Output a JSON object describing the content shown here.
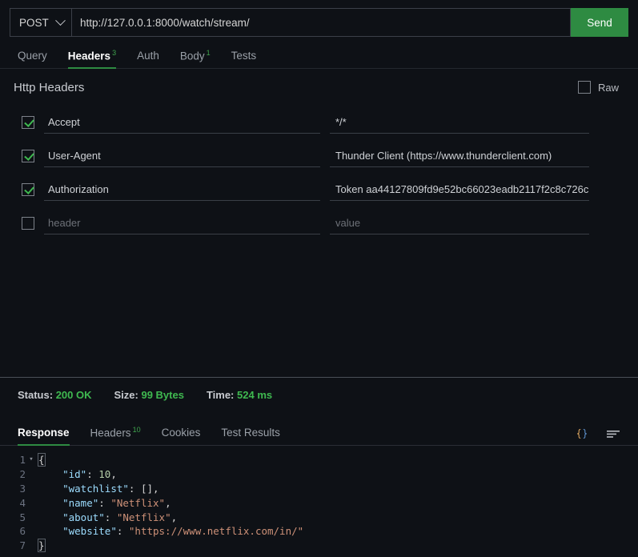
{
  "request": {
    "method": "POST",
    "url": "http://127.0.0.1:8000/watch/stream/",
    "send_label": "Send",
    "method_icon": "chevron-down-icon"
  },
  "request_tabs": [
    {
      "label": "Query",
      "badge": "",
      "active": false
    },
    {
      "label": "Headers",
      "badge": "3",
      "active": true
    },
    {
      "label": "Auth",
      "badge": "",
      "active": false
    },
    {
      "label": "Body",
      "badge": "1",
      "active": false
    },
    {
      "label": "Tests",
      "badge": "",
      "active": false
    }
  ],
  "headers_panel": {
    "title": "Http Headers",
    "raw_label": "Raw",
    "raw_checked": false,
    "name_placeholder": "header",
    "value_placeholder": "value",
    "rows": [
      {
        "checked": true,
        "name": "Accept",
        "value": "*/*"
      },
      {
        "checked": true,
        "name": "User-Agent",
        "value": "Thunder Client (https://www.thunderclient.com)"
      },
      {
        "checked": true,
        "name": "Authorization",
        "value": "Token aa44127809fd9e52bc66023eadb2117f2c8c726c"
      },
      {
        "checked": false,
        "name": "",
        "value": ""
      }
    ]
  },
  "status": {
    "status_label": "Status:",
    "status_value": "200 OK",
    "size_label": "Size:",
    "size_value": "99 Bytes",
    "time_label": "Time:",
    "time_value": "524 ms"
  },
  "response_tabs": [
    {
      "label": "Response",
      "badge": "",
      "active": true
    },
    {
      "label": "Headers",
      "badge": "10",
      "active": false
    },
    {
      "label": "Cookies",
      "badge": "",
      "active": false
    },
    {
      "label": "Test Results",
      "badge": "",
      "active": false
    }
  ],
  "response_icons": [
    {
      "name": "format-json-icon",
      "glyph": "{ }"
    },
    {
      "name": "filter-lines-icon",
      "glyph": ""
    }
  ],
  "response_body": {
    "language": "json",
    "lines": [
      {
        "num": "1",
        "fold": "▾",
        "tokens": [
          {
            "t": "{",
            "c": "br"
          }
        ]
      },
      {
        "num": "2",
        "fold": "",
        "tokens": [
          {
            "t": "    ",
            "c": "p"
          },
          {
            "t": "\"id\"",
            "c": "k"
          },
          {
            "t": ": ",
            "c": "p"
          },
          {
            "t": "10",
            "c": "n"
          },
          {
            "t": ",",
            "c": "p"
          }
        ]
      },
      {
        "num": "3",
        "fold": "",
        "tokens": [
          {
            "t": "    ",
            "c": "p"
          },
          {
            "t": "\"watchlist\"",
            "c": "k"
          },
          {
            "t": ": [],",
            "c": "p"
          }
        ]
      },
      {
        "num": "4",
        "fold": "",
        "tokens": [
          {
            "t": "    ",
            "c": "p"
          },
          {
            "t": "\"name\"",
            "c": "k"
          },
          {
            "t": ": ",
            "c": "p"
          },
          {
            "t": "\"Netflix\"",
            "c": "s"
          },
          {
            "t": ",",
            "c": "p"
          }
        ]
      },
      {
        "num": "5",
        "fold": "",
        "tokens": [
          {
            "t": "    ",
            "c": "p"
          },
          {
            "t": "\"about\"",
            "c": "k"
          },
          {
            "t": ": ",
            "c": "p"
          },
          {
            "t": "\"Netflix\"",
            "c": "s"
          },
          {
            "t": ",",
            "c": "p"
          }
        ]
      },
      {
        "num": "6",
        "fold": "",
        "tokens": [
          {
            "t": "    ",
            "c": "p"
          },
          {
            "t": "\"website\"",
            "c": "k"
          },
          {
            "t": ": ",
            "c": "p"
          },
          {
            "t": "\"https://www.netflix.com/in/\"",
            "c": "s"
          }
        ]
      },
      {
        "num": "7",
        "fold": "",
        "tokens": [
          {
            "t": "}",
            "c": "br"
          }
        ]
      }
    ]
  },
  "colors": {
    "accent_green": "#2e8b42",
    "check_green": "#3fb950",
    "background": "#0e1116",
    "json_key": "#9cdcfe",
    "json_string": "#ce9178",
    "json_number": "#b5cea8"
  }
}
